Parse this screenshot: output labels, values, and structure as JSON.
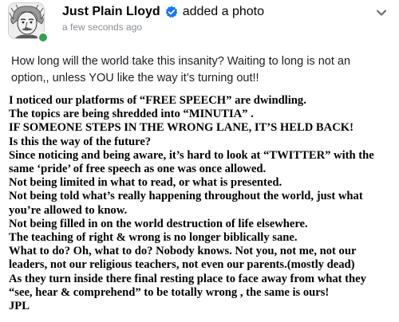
{
  "post": {
    "author": "Just Plain Lloyd",
    "action": "added a photo",
    "timestamp": "a few seconds ago",
    "verified_badge_icon": "verified-check-icon",
    "options_icon": "chevron-down-icon",
    "intro": "How long will the world take this insanity? Waiting to long is not an option,, unless YOU like the way it’s turning out!!",
    "body_lines": [
      "I noticed our platforms of “FREE SPEECH” are dwindling.",
      "The topics are being shredded into “MINUTIA” .",
      "IF SOMEONE STEPS IN THE WRONG LANE, IT’S HELD BACK!",
      "Is this the way of the future?",
      "Since noticing and being aware, it’s hard to look at “TWITTER” with the",
      "same ‘pride’ of free speech as one was once allowed.",
      "Not being limited in what to read, or what is presented.",
      "Not being told what’s really happening throughout the world, just what",
      "you’re allowed to know.",
      "Not being filled in on the world destruction of life elsewhere.",
      "The teaching of right & wrong is no longer biblically sane.",
      "What to do? Oh, what to do? Nobody knows. Not you, not me, not our",
      "leaders, not our religious teachers, not even our parents.(mostly dead)",
      "As they turn inside there final resting place to face away from what they",
      "“see, hear & comprehend” to be totally wrong , the same is ours!",
      "JPL"
    ]
  },
  "colors": {
    "verified_blue": "#1877f2",
    "online_green": "#31a24c",
    "timestamp_gray": "#8a8d91"
  }
}
